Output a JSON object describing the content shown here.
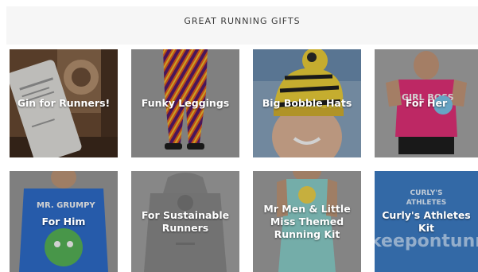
{
  "header": {
    "title": "GREAT RUNNING GIFTS"
  },
  "tiles": [
    {
      "label": "Gin for Runners!"
    },
    {
      "label": "Funky Leggings"
    },
    {
      "label": "Big Bobble Hats"
    },
    {
      "label": "For Her"
    },
    {
      "label": "For Him"
    },
    {
      "label": "For Sustainable Runners"
    },
    {
      "label": "Mr Men & Little Miss Themed Running Kit"
    },
    {
      "label": "Curly's Athletes Kit"
    }
  ],
  "photo_text": {
    "for_her_shirt": "GIRL BOSS",
    "for_him_shirt": "MR. GRUMPY",
    "curlys_shirt_line1": "CURLY'S",
    "curlys_shirt_line2": "ATHLETES",
    "curlys_banner": "keepontunnin"
  },
  "colors": {
    "header_bg": "#f6f6f6",
    "title_text": "#3a3a3a",
    "label_text": "#ffffff"
  }
}
